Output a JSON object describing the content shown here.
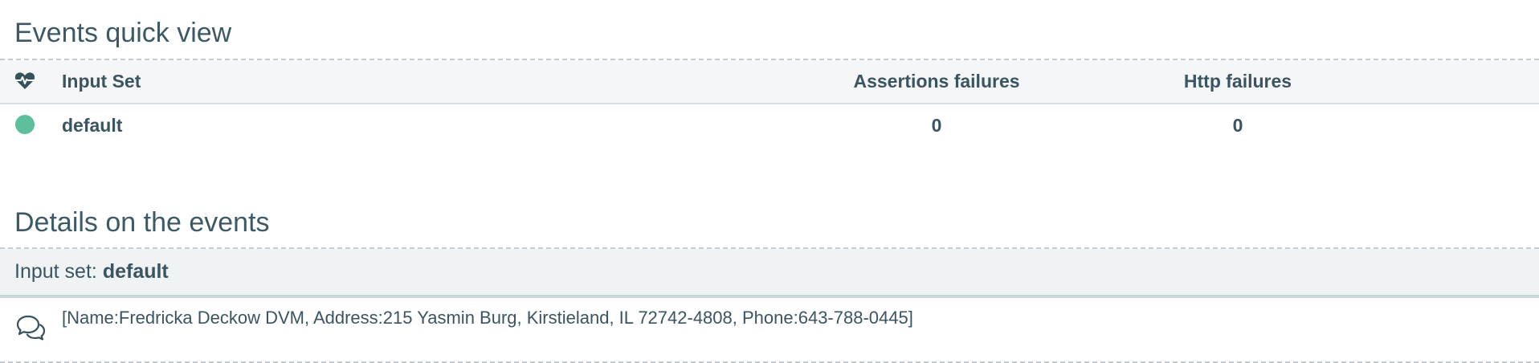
{
  "quick_view": {
    "title": "Events quick view",
    "columns": {
      "status_icon": "heart-pulse-icon",
      "input_set": "Input Set",
      "assertions_failures": "Assertions failures",
      "http_failures": "Http failures"
    },
    "rows": [
      {
        "status": "success",
        "status_color": "#5dbf9c",
        "input_set": "default",
        "assertions_failures": "0",
        "http_failures": "0"
      }
    ]
  },
  "details": {
    "title": "Details on the events",
    "input_set_label": "Input set:",
    "input_set_value": "default",
    "events": [
      {
        "icon": "comments-icon",
        "text": "[Name:Fredricka Deckow DVM, Address:215 Yasmin Burg, Kirstieland, IL 72742-4808, Phone:643-788-0445]"
      }
    ]
  }
}
